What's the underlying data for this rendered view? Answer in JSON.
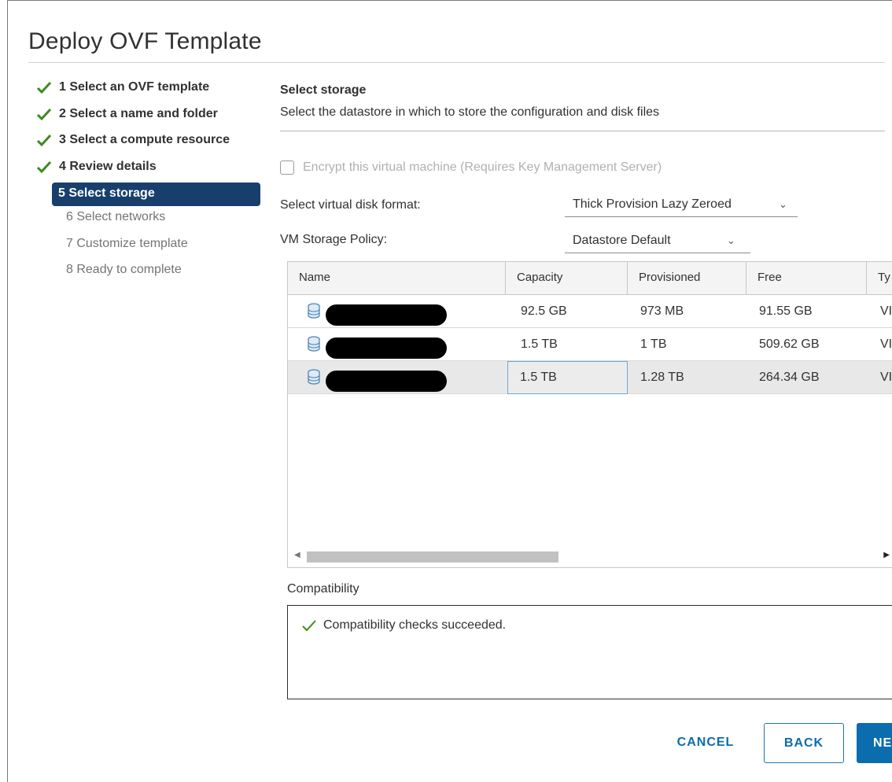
{
  "dialog": {
    "title": "Deploy OVF Template"
  },
  "steps": [
    {
      "label": "1 Select an OVF template",
      "state": "done"
    },
    {
      "label": "2 Select a name and folder",
      "state": "done"
    },
    {
      "label": "3 Select a compute resource",
      "state": "done"
    },
    {
      "label": "4 Review details",
      "state": "done"
    },
    {
      "label": "5 Select storage",
      "state": "active"
    },
    {
      "label": "6 Select networks",
      "state": "pending"
    },
    {
      "label": "7 Customize template",
      "state": "pending"
    },
    {
      "label": "8 Ready to complete",
      "state": "pending"
    }
  ],
  "storage": {
    "title": "Select storage",
    "subtitle": "Select the datastore in which to store the configuration and disk files",
    "encrypt_label": "Encrypt this virtual machine (Requires Key Management Server)",
    "disk_format_label": "Select virtual disk format:",
    "disk_format_value": "Thick Provision Lazy Zeroed",
    "policy_label": "VM Storage Policy:",
    "policy_value": "Datastore Default"
  },
  "grid": {
    "columns": [
      "Name",
      "Capacity",
      "Provisioned",
      "Free",
      "Ty"
    ],
    "rows": [
      {
        "capacity": "92.5 GB",
        "provisioned": "973 MB",
        "free": "91.55 GB",
        "type": "VI"
      },
      {
        "capacity": "1.5 TB",
        "provisioned": "1 TB",
        "free": "509.62 GB",
        "type": "VI"
      },
      {
        "capacity": "1.5 TB",
        "provisioned": "1.28 TB",
        "free": "264.34 GB",
        "type": "VI"
      }
    ]
  },
  "compatibility": {
    "label": "Compatibility",
    "message": "Compatibility checks succeeded."
  },
  "buttons": {
    "cancel": "CANCEL",
    "back": "BACK",
    "next": "NE"
  },
  "colors": {
    "accent": "#0b6cae",
    "active_step": "#183f6c",
    "success": "#3c8a1e"
  }
}
